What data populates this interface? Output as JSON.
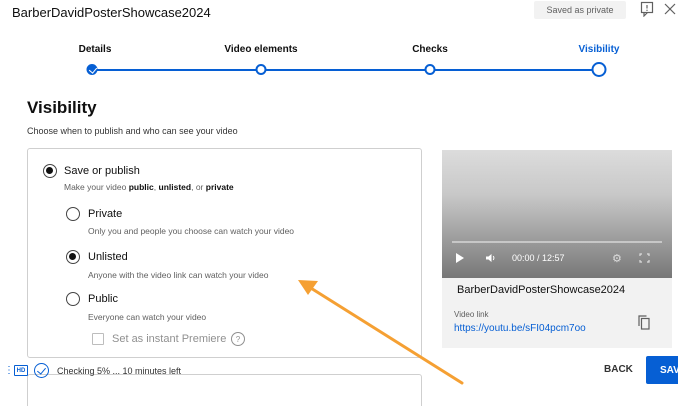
{
  "header": {
    "title": "BarberDavidPosterShowcase2024",
    "saved_badge": "Saved as private",
    "feedback_icon": "feedback-icon",
    "close_icon": "close-icon"
  },
  "stepper": {
    "steps": [
      {
        "label": "Details",
        "state": "done"
      },
      {
        "label": "Video elements",
        "state": "upcoming"
      },
      {
        "label": "Checks",
        "state": "upcoming"
      },
      {
        "label": "Visibility",
        "state": "current"
      }
    ]
  },
  "visibility": {
    "heading": "Visibility",
    "subheading": "Choose when to publish and who can see your video",
    "save_or_publish": {
      "label": "Save or publish",
      "desc_prefix": "Make your video ",
      "desc_public": "public",
      "desc_sep1": ", ",
      "desc_unlisted": "unlisted",
      "desc_sep2": ", or ",
      "desc_private": "private",
      "selected": true
    },
    "options": [
      {
        "label": "Private",
        "desc": "Only you and people you choose can watch your video",
        "selected": false
      },
      {
        "label": "Unlisted",
        "desc": "Anyone with the video link can watch your video",
        "selected": true
      },
      {
        "label": "Public",
        "desc": "Everyone can watch your video",
        "selected": false
      }
    ],
    "premiere": {
      "label": "Set as instant Premiere",
      "checked": false,
      "help": "?"
    }
  },
  "preview": {
    "time": "00:00 / 12:57",
    "video_name": "BarberDavidPosterShowcase2024",
    "link_label": "Video link",
    "link": "https://youtu.be/sFI04pcm7oo"
  },
  "footer": {
    "hd_label": "HD",
    "status": "Checking 5% ... 10 minutes left",
    "back_label": "BACK",
    "save_label": "SAVE"
  },
  "colors": {
    "accent": "#065fd4",
    "annotation_arrow": "#f5a033"
  }
}
